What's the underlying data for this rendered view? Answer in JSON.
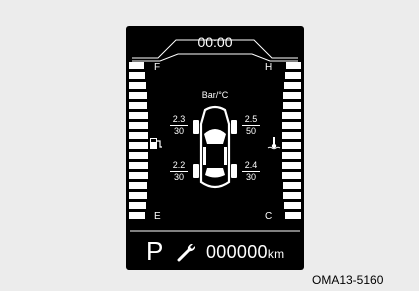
{
  "clock": "00:00",
  "gauge": {
    "left_top_label": "F",
    "left_bottom_label": "E",
    "right_top_label": "H",
    "right_bottom_label": "C",
    "left_level": 1.0,
    "right_level": 1.0
  },
  "tpms": {
    "unit_label": "Bar/°C",
    "front_left": {
      "pressure": "2.3",
      "temp": "30"
    },
    "front_right": {
      "pressure": "2.5",
      "temp": "50"
    },
    "rear_left": {
      "pressure": "2.2",
      "temp": "30"
    },
    "rear_right": {
      "pressure": "2.4",
      "temp": "30"
    }
  },
  "gear": "P",
  "odometer": {
    "value": "000000",
    "unit": "km"
  },
  "figure_code": "OMA13-5160",
  "icons": [
    "fuel-icon",
    "coolant-temperature-icon",
    "car-top-view-icon",
    "wrench-icon"
  ]
}
